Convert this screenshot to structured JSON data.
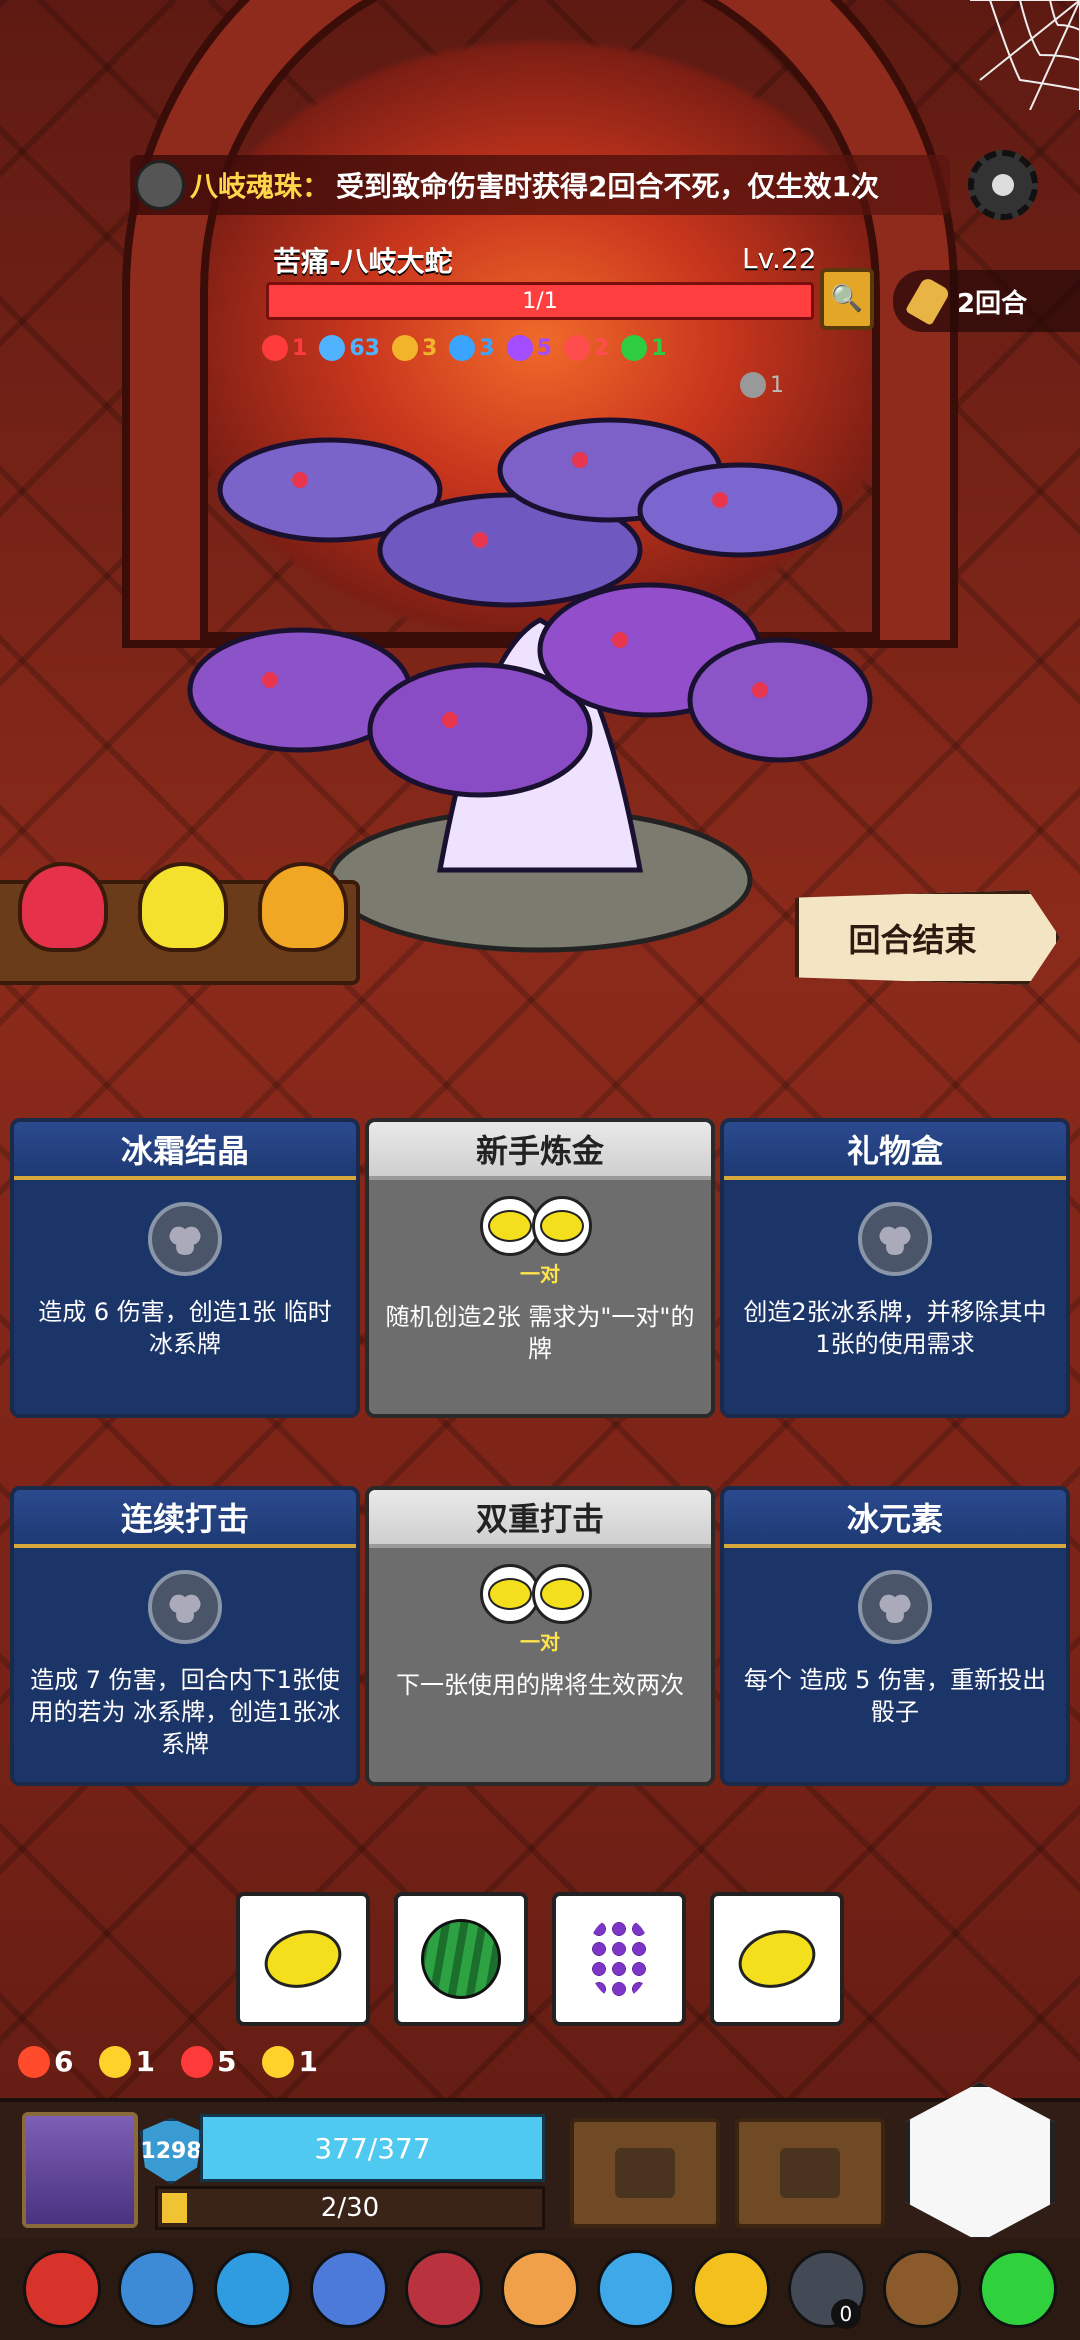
{
  "relic_info": {
    "name": "八岐魂珠：",
    "description": "受到致命伤害时获得2回合不死，仅生效1次"
  },
  "enemy": {
    "name": "苦痛-八岐大蛇",
    "level": "Lv.22",
    "hp_text": "1/1",
    "statuses": [
      {
        "icon": "fire-claw-icon",
        "color": "#ff3b3b",
        "value": "1"
      },
      {
        "icon": "snowflake-icon",
        "color": "#4fb3ff",
        "value": "63"
      },
      {
        "icon": "lock-icon",
        "color": "#f1b42a",
        "value": "3"
      },
      {
        "icon": "speech-bubble-icon",
        "color": "#3aa5ff",
        "value": "3"
      },
      {
        "icon": "spark-icon",
        "color": "#a24dff",
        "value": "5"
      },
      {
        "icon": "broken-heart-icon",
        "color": "#ff4d4d",
        "value": "2"
      },
      {
        "icon": "poison-swirl-icon",
        "color": "#2ecc40",
        "value": "1"
      }
    ],
    "extra_status": {
      "icon": "skull-icon",
      "value": "1"
    }
  },
  "turn_counter": "2回合",
  "end_turn_label": "回合结束",
  "potions": [
    {
      "color": "#e5324a"
    },
    {
      "color": "#f3e12d"
    },
    {
      "color": "#f0a824"
    }
  ],
  "cards": [
    {
      "title": "冰霜结晶",
      "type": "blue",
      "slot": true,
      "requirement": "",
      "desc": "造成 6 伤害，创造1张 临时 冰系牌"
    },
    {
      "title": "新手炼金",
      "type": "gray",
      "slot": false,
      "requirement": "一对",
      "desc": "随机创造2张 需求为\"一对\"的牌"
    },
    {
      "title": "礼物盒",
      "type": "blue",
      "slot": true,
      "requirement": "",
      "desc": "创造2张冰系牌，并移除其中1张的使用需求"
    },
    {
      "title": "连续打击",
      "type": "blue",
      "slot": true,
      "requirement": "",
      "desc": "造成 7 伤害，回合内下1张使用的若为 冰系牌，创造1张冰系牌"
    },
    {
      "title": "双重打击",
      "type": "gray",
      "slot": false,
      "requirement": "一对",
      "desc": "下一张使用的牌将生效两次"
    },
    {
      "title": "冰元素",
      "type": "blue",
      "slot": true,
      "requirement": "",
      "desc": "每个 造成 5 伤害，重新投出骰子"
    }
  ],
  "dice": [
    "lemon",
    "watermelon",
    "grape",
    "lemon"
  ],
  "player_stats": [
    {
      "icon": "strength-gear-icon",
      "color": "#ff4b2b",
      "value": "6"
    },
    {
      "icon": "lightning-icon",
      "color": "#ffd12b",
      "value": "1"
    },
    {
      "icon": "swirl-icon",
      "color": "#ff3a3a",
      "value": "5"
    },
    {
      "icon": "shield-icon",
      "color": "#ffd12b",
      "value": "1"
    }
  ],
  "player": {
    "armor": "1298",
    "hp_text": "377/377",
    "hp_fraction": 1.0,
    "exp_text": "2/30",
    "exp_fraction": 0.067
  },
  "relics": [
    {
      "icon": "flame-potion-icon",
      "color": "#d8332b"
    },
    {
      "icon": "blue-crystal-icon",
      "color": "#3d8bd6"
    },
    {
      "icon": "water-drop-icon",
      "color": "#2f9be0"
    },
    {
      "icon": "blue-mushroom-icon",
      "color": "#4c7ad8"
    },
    {
      "icon": "bracelet-icon",
      "color": "#b8333d"
    },
    {
      "icon": "ring-icon",
      "color": "#f0a048"
    },
    {
      "icon": "ice-skull-icon",
      "color": "#3fa8e8"
    },
    {
      "icon": "gold-crown-icon",
      "color": "#f4c01e"
    },
    {
      "icon": "dark-gem-icon",
      "color": "#444a55"
    },
    {
      "icon": "shuriken-icon",
      "color": "#8a5a2a"
    },
    {
      "icon": "green-gem-icon",
      "color": "#2fd13d"
    }
  ],
  "relic_badge_count": "0"
}
